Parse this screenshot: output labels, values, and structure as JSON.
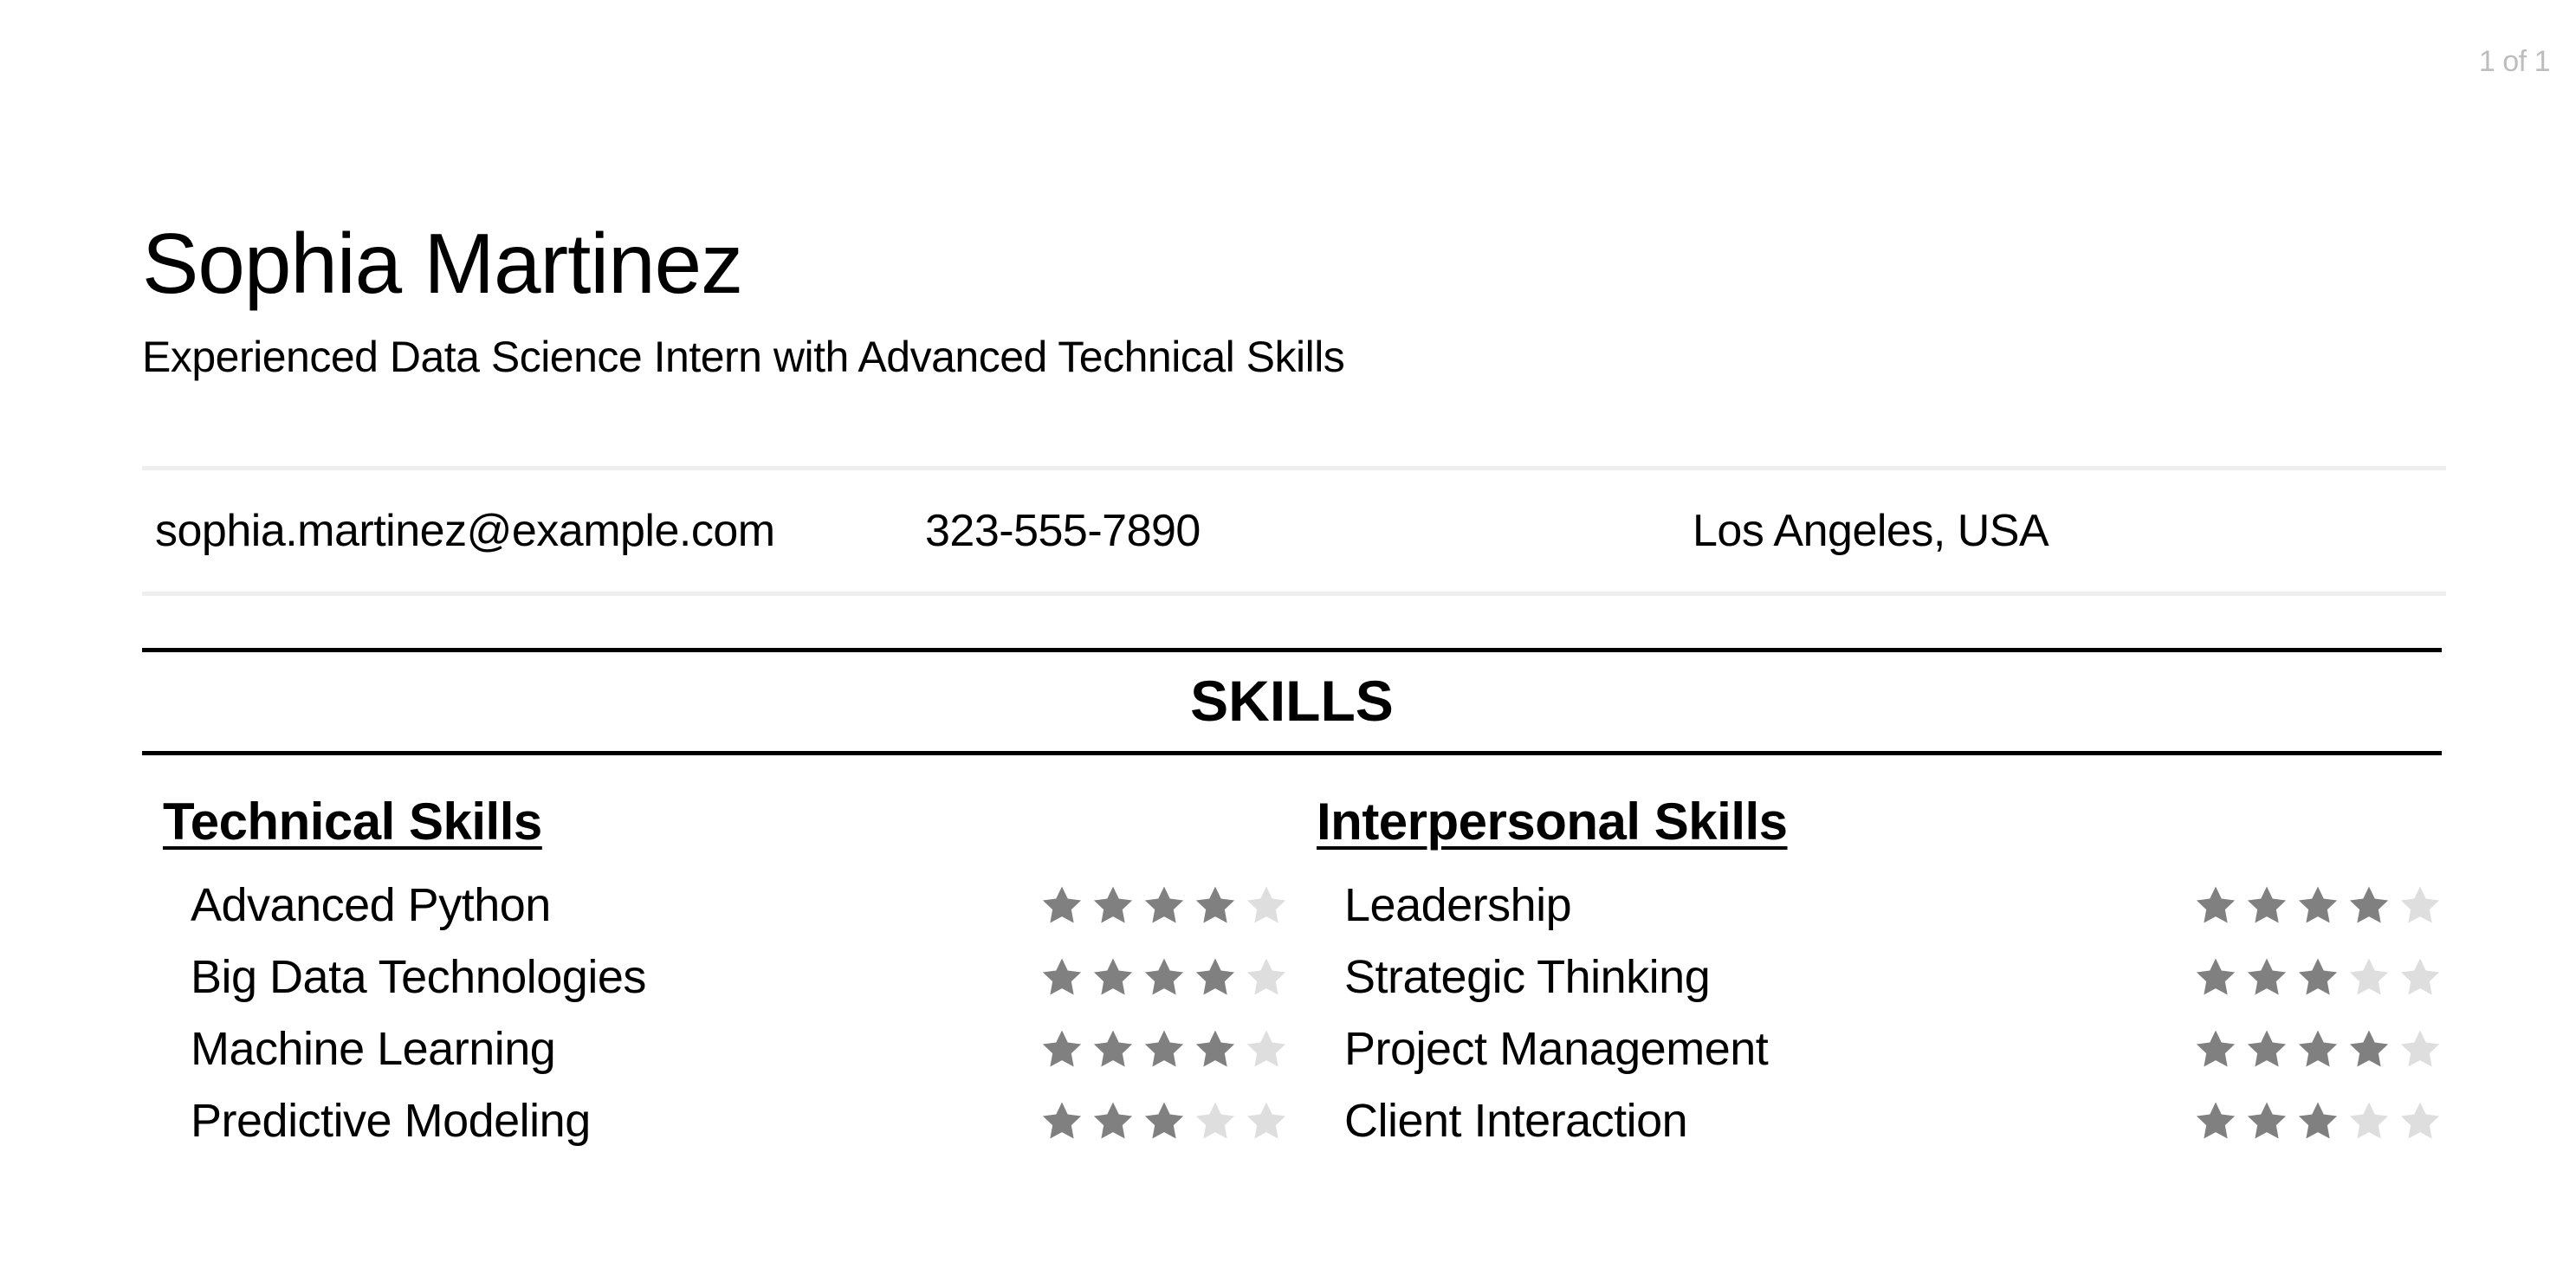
{
  "page": {
    "counter": "1 of 1"
  },
  "header": {
    "name": "Sophia Martinez",
    "tagline": "Experienced Data Science Intern with Advanced Technical Skills"
  },
  "contact": {
    "email": "sophia.martinez@example.com",
    "phone": "323-555-7890",
    "location": "Los Angeles, USA"
  },
  "colors": {
    "star_filled": "#808080",
    "star_empty": "#dedede",
    "divider_light": "#eeeeee",
    "page_counter": "#bdbdbd"
  },
  "skills": {
    "title": "SKILLS",
    "max_rating": 5,
    "technical": {
      "heading": "Technical Skills",
      "items": [
        {
          "name": "Advanced Python",
          "rating": 4
        },
        {
          "name": "Big Data Technologies",
          "rating": 4
        },
        {
          "name": "Machine Learning",
          "rating": 4
        },
        {
          "name": "Predictive Modeling",
          "rating": 3
        }
      ]
    },
    "interpersonal": {
      "heading": "Interpersonal Skills",
      "items": [
        {
          "name": "Leadership",
          "rating": 4
        },
        {
          "name": "Strategic Thinking",
          "rating": 3
        },
        {
          "name": "Project Management",
          "rating": 4
        },
        {
          "name": "Client Interaction",
          "rating": 3
        }
      ]
    }
  }
}
